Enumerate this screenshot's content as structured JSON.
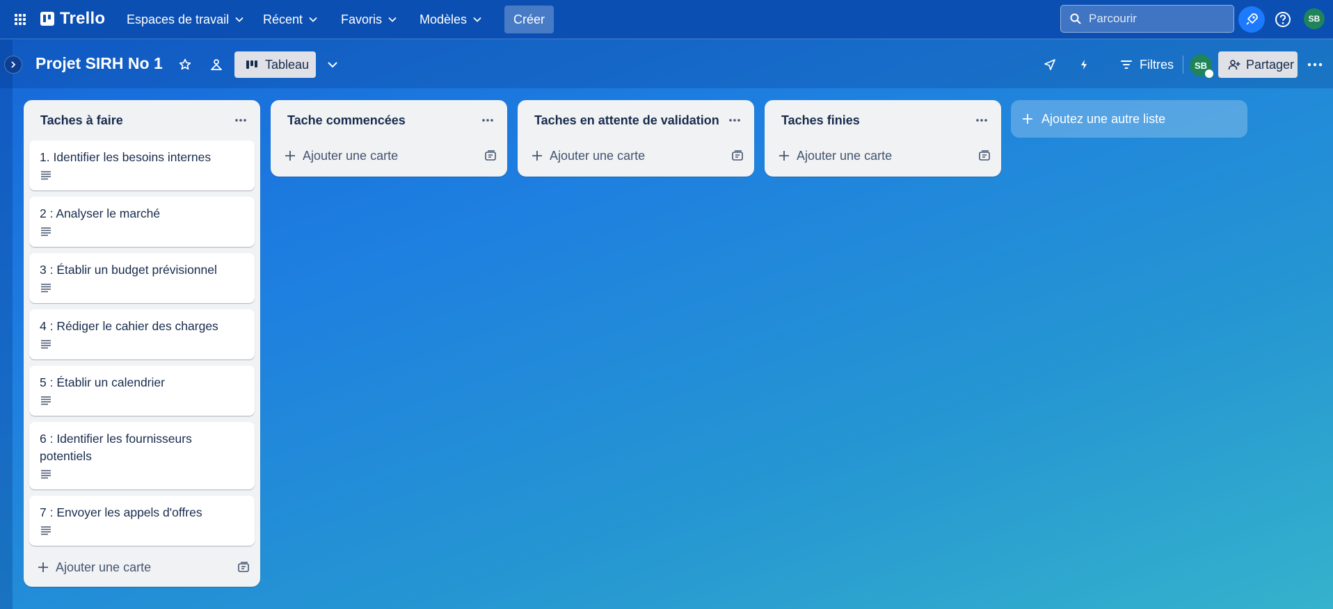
{
  "topnav": {
    "logo_text": "Trello",
    "items": [
      {
        "label": "Espaces de travail"
      },
      {
        "label": "Récent"
      },
      {
        "label": "Favoris"
      },
      {
        "label": "Modèles"
      }
    ],
    "create_label": "Créer",
    "search_placeholder": "Parcourir",
    "avatar_initials": "SB"
  },
  "board": {
    "title": "Projet SIRH No 1",
    "view_label": "Tableau",
    "filters_label": "Filtres",
    "member_initials": "SB",
    "share_label": "Partager"
  },
  "lists": [
    {
      "title": "Taches à faire",
      "cards": [
        {
          "title": "1. Identifier les besoins internes"
        },
        {
          "title": "2 : Analyser le marché"
        },
        {
          "title": "3 : Établir un budget prévisionnel"
        },
        {
          "title": "4 : Rédiger le cahier des charges"
        },
        {
          "title": "5 : Établir un calendrier"
        },
        {
          "title": "6 : Identifier les fournisseurs potentiels"
        },
        {
          "title": "7 : Envoyer les appels d'offres"
        }
      ],
      "add_card_label": "Ajouter une carte"
    },
    {
      "title": "Tache commencées",
      "cards": [],
      "add_card_label": "Ajouter une carte"
    },
    {
      "title": "Taches en attente de validation",
      "cards": [],
      "add_card_label": "Ajouter une carte"
    },
    {
      "title": "Taches finies",
      "cards": [],
      "add_card_label": "Ajouter une carte"
    }
  ],
  "add_list_label": "Ajoutez une autre liste",
  "colors": {
    "nav_bg": "#0b4fb3",
    "accent": "#1d7afc",
    "avatar": "#1f845a",
    "list_bg": "#f1f2f4"
  }
}
